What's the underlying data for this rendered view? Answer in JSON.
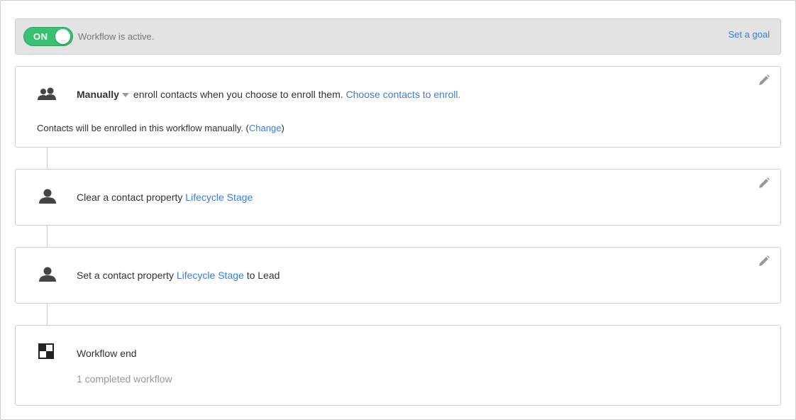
{
  "status": {
    "toggle_label": "ON",
    "text": "Workflow is active.",
    "goal_link": "Set a goal"
  },
  "enrollment": {
    "mode": "Manually",
    "description": "enroll contacts when you choose to enroll them.",
    "choose_link": "Choose contacts to enroll.",
    "note_prefix": "Contacts will be enrolled in this workflow manually. (",
    "change_link": "Change",
    "note_suffix": ")"
  },
  "steps": [
    {
      "prefix": "Clear a contact property ",
      "property": "Lifecycle Stage",
      "suffix": ""
    },
    {
      "prefix": "Set a contact property ",
      "property": "Lifecycle Stage",
      "suffix": " to Lead"
    }
  ],
  "end": {
    "title": "Workflow end",
    "completed": "1 completed workflow"
  },
  "colors": {
    "accent": "#3b7dd8",
    "toggle_on": "#38c172"
  },
  "icons": {
    "enroll": "contacts-group-icon",
    "step": "contact-person-icon",
    "end": "checkered-flag-icon",
    "edit": "pencil-icon"
  }
}
